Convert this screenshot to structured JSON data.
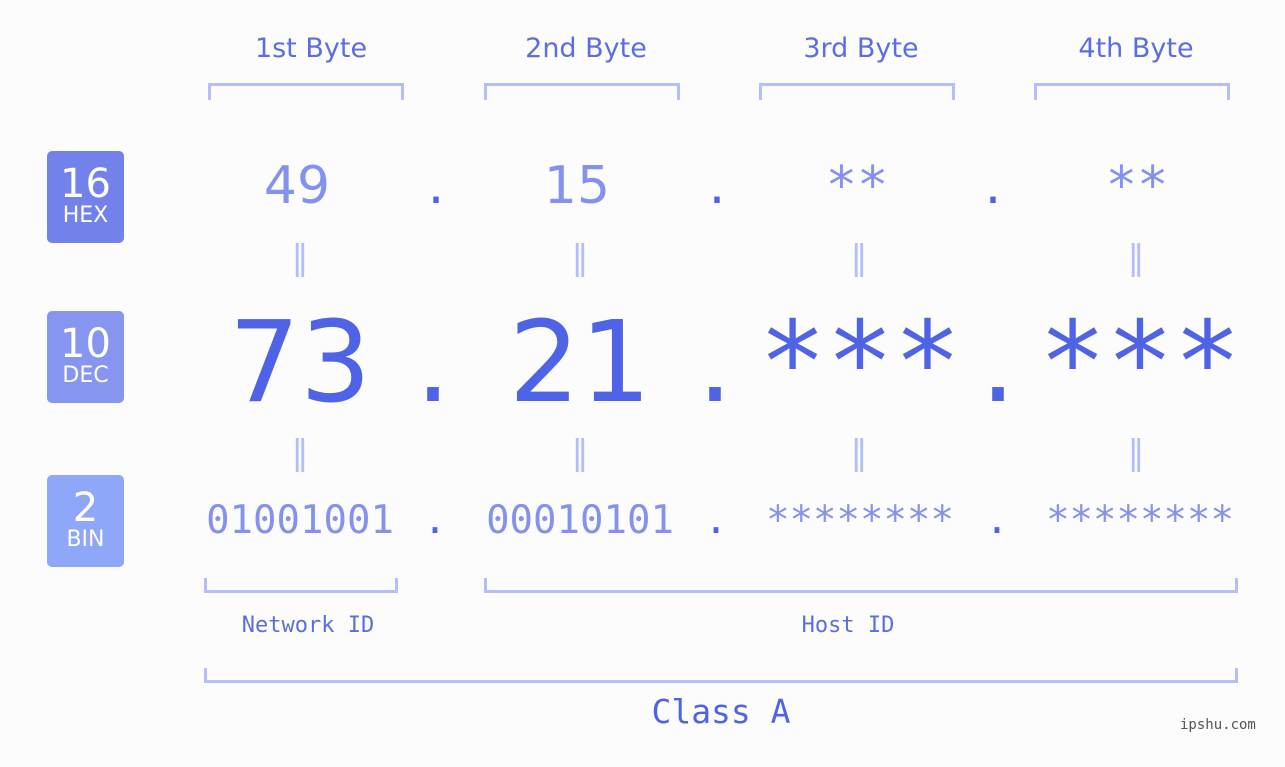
{
  "byte_headers": [
    "1st Byte",
    "2nd Byte",
    "3rd Byte",
    "4th Byte"
  ],
  "badges": [
    {
      "number": "16",
      "label": "HEX",
      "color": "#7382ea"
    },
    {
      "number": "10",
      "label": "DEC",
      "color": "#8595f0"
    },
    {
      "number": "2",
      "label": "BIN",
      "color": "#8fa7f8"
    }
  ],
  "hex": [
    "49",
    "15",
    "**",
    "**"
  ],
  "dec": [
    "73",
    "21",
    "***",
    "***"
  ],
  "bin": [
    "01001001",
    "00010101",
    "********",
    "********"
  ],
  "separator": ".",
  "equals": "=",
  "network_id_label": "Network ID",
  "host_id_label": "Host ID",
  "class_label": "Class A",
  "watermark": "ipshu.com"
}
